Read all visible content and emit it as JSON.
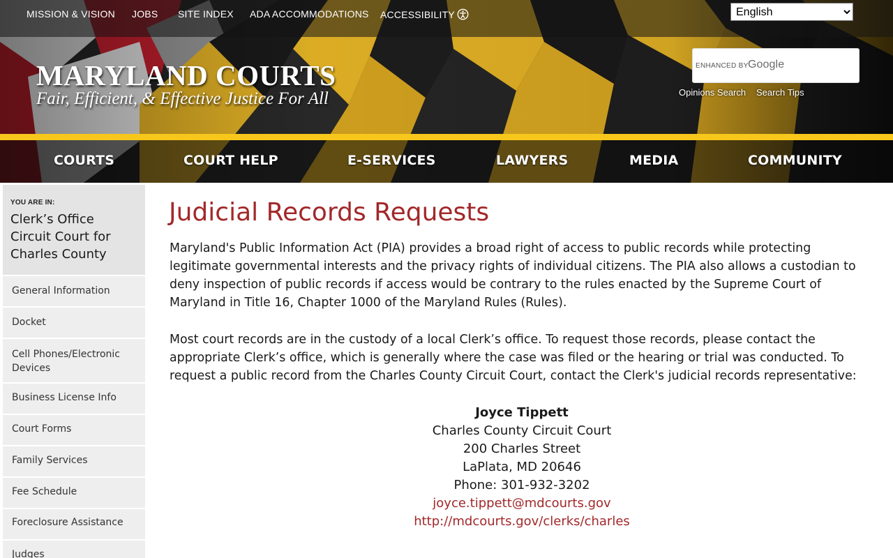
{
  "utility_nav": {
    "items": [
      "MISSION & VISION",
      "JOBS",
      "SITE INDEX",
      "ADA ACCOMMODATIONS",
      "ACCESSIBILITY"
    ],
    "language": "English"
  },
  "logo": {
    "title": "MARYLAND COURTS",
    "tagline": "Fair, Efficient, & Effective Justice For All"
  },
  "search": {
    "enhanced_label": "ENHANCED BY",
    "provider": "Google",
    "links": [
      "Opinions Search",
      "Search Tips"
    ]
  },
  "main_nav": {
    "items": [
      "COURTS",
      "COURT HELP",
      "E-SERVICES",
      "LAWYERS",
      "MEDIA",
      "COMMUNITY"
    ]
  },
  "sidebar": {
    "you_are_in_label": "YOU ARE IN:",
    "you_are_in_title": "Clerk’s Office Circuit Court for Charles County",
    "items": [
      "General Information",
      "Docket",
      "Cell Phones/Electronic Devices",
      "Business License Info",
      "Court Forms",
      "Family Services",
      "Fee Schedule",
      "Foreclosure Assistance",
      "Judges"
    ]
  },
  "content": {
    "title": "Judicial Records Requests",
    "paragraph_1": "Maryland's Public Information Act (PIA) provides a broad right of access to public records while protecting legitimate governmental interests and the privacy rights of individual citizens.  The PIA also allows a custodian to deny inspection of public records if access would be contrary to the rules enacted by the Supreme Court of Maryland in Title 16, Chapter 1000 of the Maryland Rules (Rules).",
    "paragraph_2": "Most court records are in the custody of a local Clerk’s office.  To request those records, please contact the appropriate Clerk’s office, which is generally where the case was filed or the hearing or trial was conducted.  To request a public record from the Charles County Circuit Court, contact the Clerk's judicial records representative:",
    "contact": {
      "name": "Joyce Tippett",
      "organization": "Charles County Circuit Court",
      "street": "200 Charles Street",
      "city": "LaPlata, MD 20646",
      "phone": "Phone: 301-932-3202",
      "email": "joyce.tippett@mdcourts.gov",
      "website": "http://mdcourts.gov/clerks/charles"
    }
  },
  "colors": {
    "accent_red": "#a2282a",
    "flag_gold": "#f8c71b",
    "flag_black": "#1c1c1c",
    "flag_red": "#c8202f",
    "sidebar_bg": "#eeeeee"
  }
}
